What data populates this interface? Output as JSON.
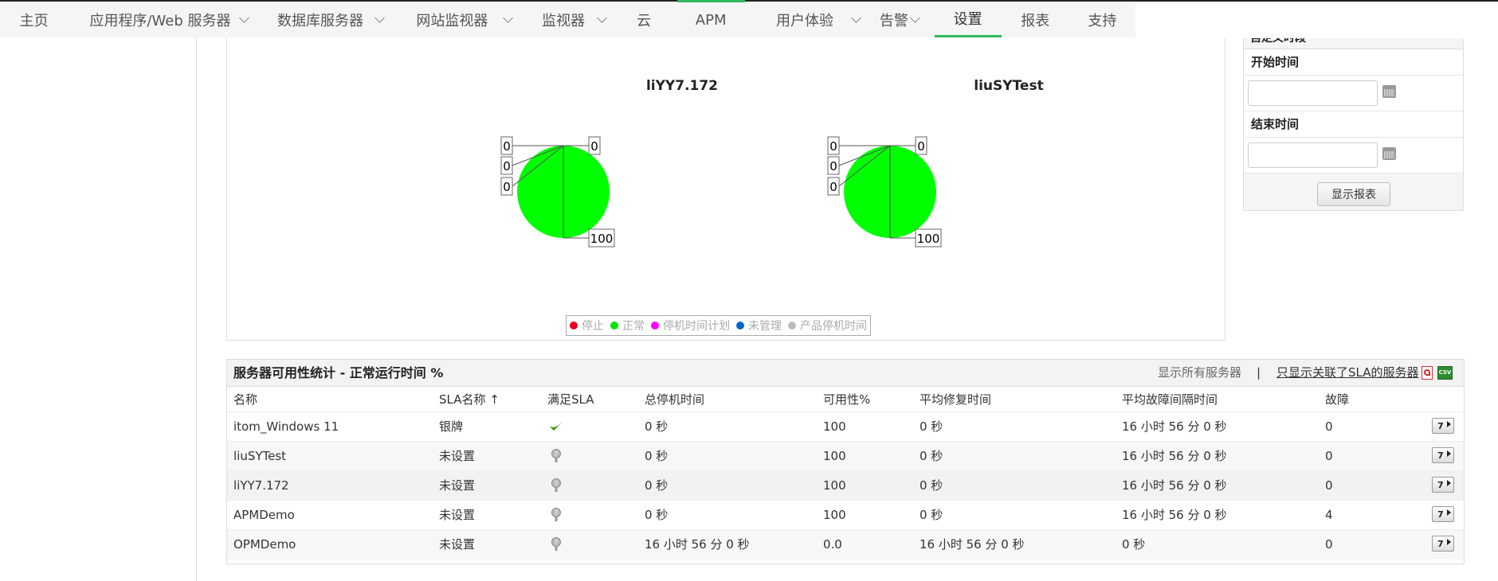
{
  "nav": {
    "items": [
      {
        "label": "主页",
        "dropdown": false
      },
      {
        "label": "应用程序/Web 服务器",
        "dropdown": true
      },
      {
        "label": "数据库服务器",
        "dropdown": true
      },
      {
        "label": "网站监视器",
        "dropdown": true
      },
      {
        "label": "监视器",
        "dropdown": true
      },
      {
        "label": "云",
        "dropdown": false
      },
      {
        "label": "APM",
        "dropdown": false
      },
      {
        "label": "用户体验",
        "dropdown": true
      },
      {
        "label": "告警",
        "dropdown": true
      },
      {
        "label": "设置",
        "dropdown": false,
        "active": true
      },
      {
        "label": "报表",
        "dropdown": false
      },
      {
        "label": "支持",
        "dropdown": false
      }
    ]
  },
  "pies": [
    {
      "title": "liYY7.172",
      "labels_left": [
        "0",
        "0",
        "0"
      ],
      "label_right_top": "0",
      "label_right_bottom": "100"
    },
    {
      "title": "liuSYTest",
      "labels_left": [
        "0",
        "0",
        "0"
      ],
      "label_right_top": "0",
      "label_right_bottom": "100"
    }
  ],
  "legend": {
    "items": [
      {
        "label": "停止",
        "color": "#e8001c"
      },
      {
        "label": "正常",
        "color": "#00e600"
      },
      {
        "label": "停机时间计划",
        "color": "#ff00ff"
      },
      {
        "label": "未管理",
        "color": "#0066cc"
      },
      {
        "label": "产品停机时间",
        "color": "#bbbbbb"
      }
    ]
  },
  "custom_period": {
    "heading": "自定义时段",
    "start_label": "开始时间",
    "end_label": "结束时间",
    "show_button": "显示报表",
    "start_value": "",
    "end_value": ""
  },
  "availability": {
    "title": "服务器可用性统计 - 正常运行时间 %",
    "show_all": "显示所有服务器",
    "separator": "|",
    "show_sla_only": "只显示关联了SLA的服务器",
    "csv_label": "CSV",
    "headers": {
      "name": "名称",
      "sla_name": "SLA名称",
      "sort_arrow": "↑",
      "meet_sla": "满足SLA",
      "total_downtime": "总停机时间",
      "availability": "可用性%",
      "mttr": "平均修复时间",
      "mtbf": "平均故障间隔时间",
      "faults": "故障"
    },
    "report_button_label": "7",
    "rows": [
      {
        "name": "itom_Windows 11",
        "sla": "银牌",
        "meet": "check",
        "downtime": "0 秒",
        "availability": "100",
        "mttr": "0 秒",
        "mtbf": "16 小时 56 分 0 秒",
        "faults": "0"
      },
      {
        "name": "liuSYTest",
        "sla": "未设置",
        "meet": "help",
        "downtime": "0 秒",
        "availability": "100",
        "mttr": "0 秒",
        "mtbf": "16 小时 56 分 0 秒",
        "faults": "0"
      },
      {
        "name": "liYY7.172",
        "sla": "未设置",
        "meet": "help",
        "downtime": "0 秒",
        "availability": "100",
        "mttr": "0 秒",
        "mtbf": "16 小时 56 分 0 秒",
        "faults": "0"
      },
      {
        "name": "APMDemo",
        "sla": "未设置",
        "meet": "help",
        "downtime": "0 秒",
        "availability": "100",
        "mttr": "0 秒",
        "mtbf": "16 小时 56 分 0 秒",
        "faults": "4"
      },
      {
        "name": "OPMDemo",
        "sla": "未设置",
        "meet": "help",
        "downtime": "16 小时 56 分 0 秒",
        "availability": "0.0",
        "mttr": "16 小时 56 分 0 秒",
        "mtbf": "0 秒",
        "faults": "0"
      }
    ]
  }
}
